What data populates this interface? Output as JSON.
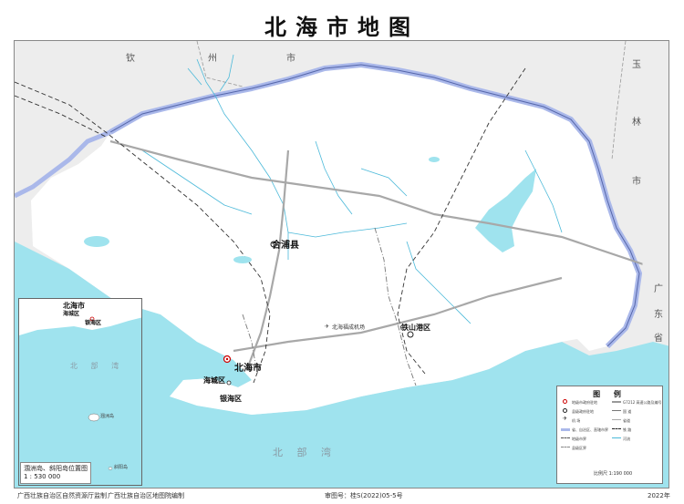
{
  "title": "北海市地图",
  "regions": {
    "qin_char1": "钦",
    "qin_char2": "州",
    "qin_char3": "市",
    "yu_char1": "玉",
    "yu_char2": "林",
    "yu_char3": "市",
    "guangdong_char1": "广",
    "guangdong_char2": "东",
    "guangdong_char3": "省"
  },
  "cities": {
    "hepu": "合浦县",
    "beihai": "北海市",
    "haicheng": "海城区",
    "yinhai": "银海区",
    "tieshangang": "铁山港区"
  },
  "airport": "北海福成机场",
  "sea": "北 部 湾",
  "legend": {
    "title": "图 例",
    "items": [
      "地级市政府驻地",
      "县级政府驻地",
      "机  场",
      "省、自治区、直辖市界",
      "地级市界",
      "县级区界",
      "G7212 高速公路及编号",
      "国  道",
      "省道",
      "铁  路",
      "河流"
    ]
  },
  "scale_text": "比例尺 1:190 000",
  "inset": {
    "city": "北海市",
    "district1": "海城区",
    "district2": "银海区",
    "island": "涠洲岛",
    "sea": "北 部 湾",
    "island2": "斜阳岛",
    "label_line1": "涠洲岛、斜阳岛位置图",
    "label_line2": "1 : 530 000"
  },
  "footer": {
    "supervisor": "广西壮族自治区自然资源厅监制",
    "compiler": "广西壮族自治区地图院编制",
    "approval": "审图号：桂S(2022)05-5号",
    "year": "2022年"
  },
  "colors": {
    "sea": "#9fe3ee",
    "land": "#ffffff",
    "outside": "#ededed",
    "border": "#aab8ea",
    "river": "#4bb9d9"
  }
}
